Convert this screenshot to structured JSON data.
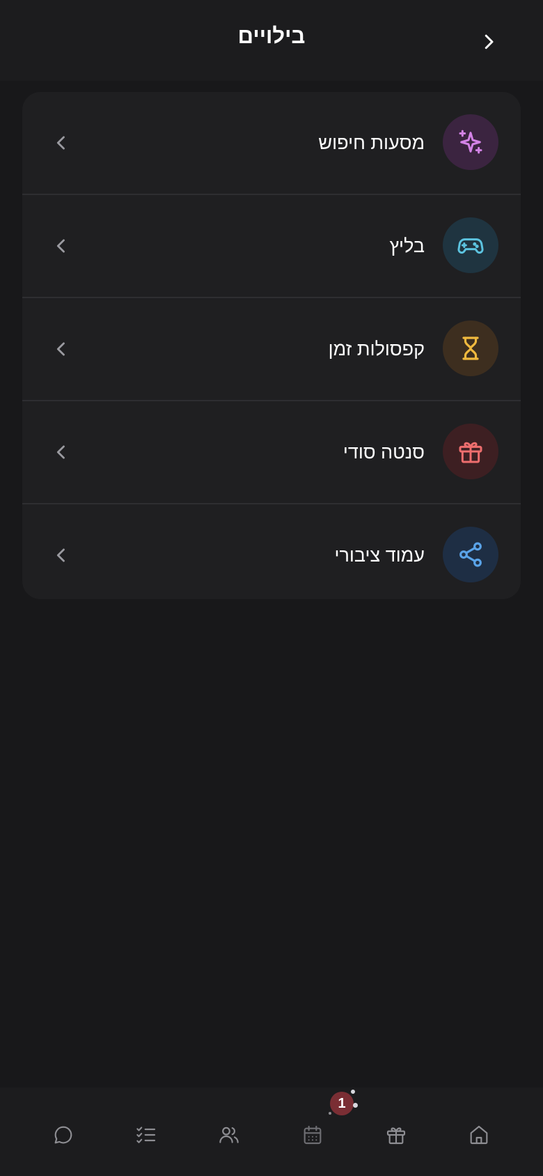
{
  "header": {
    "title": "בילויים",
    "back_icon": "chevron-right-icon"
  },
  "items": [
    {
      "label": "מסעות חיפוש",
      "icon": "sparkles-icon",
      "icon_color": "#d383e6",
      "icon_bg": "#3b2440"
    },
    {
      "label": "בליץ",
      "icon": "gamepad-icon",
      "icon_color": "#5cc3df",
      "icon_bg": "#1f3440"
    },
    {
      "label": "קפסולות זמן",
      "icon": "hourglass-icon",
      "icon_color": "#f0b93e",
      "icon_bg": "#3d2e1f"
    },
    {
      "label": "סנטה סודי",
      "icon": "gift-icon",
      "icon_color": "#ee6e6e",
      "icon_bg": "#3d1f22"
    },
    {
      "label": "עמוד ציבורי",
      "icon": "share-icon",
      "icon_color": "#5aa3e8",
      "icon_bg": "#1e2e44"
    }
  ],
  "tabbar": {
    "tabs": [
      {
        "icon": "chat-icon"
      },
      {
        "icon": "checklist-icon"
      },
      {
        "icon": "users-icon"
      },
      {
        "icon": "calendar-icon",
        "badge": "1"
      },
      {
        "icon": "gift-icon"
      },
      {
        "icon": "home-icon"
      }
    ]
  },
  "colors": {
    "background": "#18181a",
    "surface": "#1f1f21",
    "chevron": "#9a9aa0",
    "tab_icon": "#8e8e93",
    "badge": "#7a2e34"
  }
}
